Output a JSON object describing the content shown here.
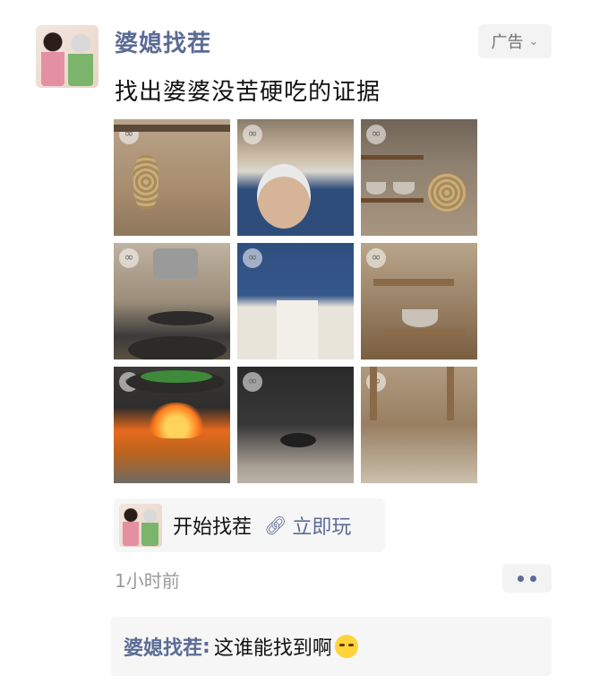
{
  "post": {
    "account_name": "婆媳找茬",
    "ad_label": "广告",
    "ad_icon": "chevron-down-icon",
    "text": "找出婆婆没苦硬吃的证据",
    "image_count": 9,
    "time": "1小时前"
  },
  "cta": {
    "title": "开始找茬",
    "link_icon": "link-icon",
    "action": "立即玩"
  },
  "comments": [
    {
      "author": "婆媳找茬",
      "separator": ":",
      "text": "这谁能找到啊",
      "emoji": "crying-laughing-emoji"
    }
  ],
  "colors": {
    "link_blue": "#5b6b95",
    "time_gray": "#9a9a9a",
    "panel_bg": "#f6f6f6"
  }
}
